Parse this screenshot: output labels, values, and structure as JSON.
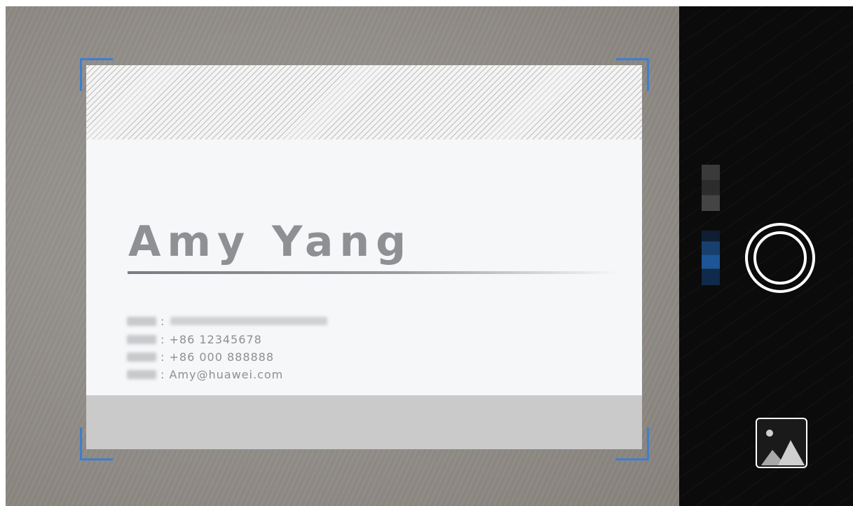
{
  "card": {
    "name": "Amy Yang",
    "phone": ": +86 12345678",
    "fax": ": +86 000 888888",
    "email": ": Amy@huawei.com",
    "address_separator": ":"
  },
  "colors": {
    "frame_corner": "#3d7fd0",
    "shutter": "#ffffff",
    "control_panel": "#0b0b0b"
  },
  "icons": {
    "shutter": "shutter-icon",
    "gallery": "gallery-icon"
  }
}
